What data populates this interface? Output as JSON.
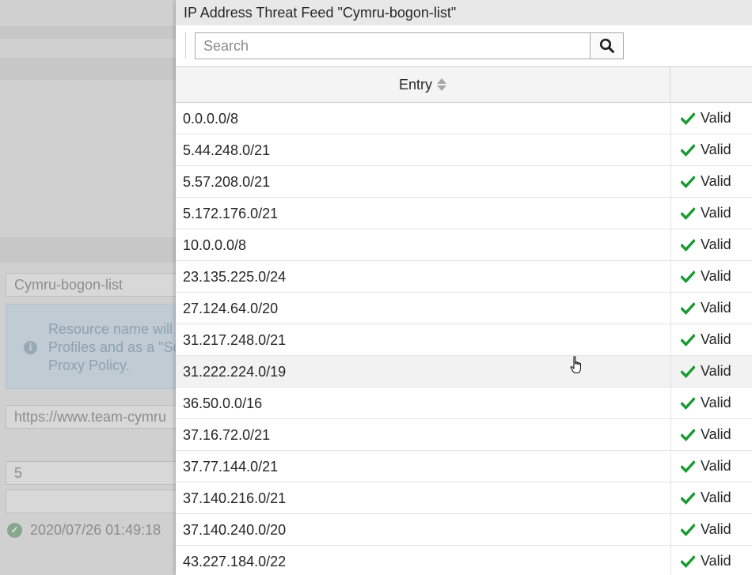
{
  "background": {
    "name_field": "Cymru-bogon-list",
    "info_lines": [
      "Resource name will",
      "Profiles and as a \"So",
      "Proxy Policy."
    ],
    "url_field": "https://www.team-cymru",
    "refresh_field": "5",
    "status_text": "2020/07/26 01:49:18",
    "status_color": "#2e9e3e"
  },
  "panel": {
    "title": "IP Address Threat Feed \"Cymru-bogon-list\"",
    "search": {
      "placeholder": "Search",
      "icon": "search-icon"
    },
    "table": {
      "columns": [
        {
          "label": "Entry",
          "sortable": true
        },
        {
          "label": ""
        }
      ],
      "rows": [
        {
          "entry": "0.0.0.0/8",
          "status": "Valid"
        },
        {
          "entry": "5.44.248.0/21",
          "status": "Valid"
        },
        {
          "entry": "5.57.208.0/21",
          "status": "Valid"
        },
        {
          "entry": "5.172.176.0/21",
          "status": "Valid"
        },
        {
          "entry": "10.0.0.0/8",
          "status": "Valid"
        },
        {
          "entry": "23.135.225.0/24",
          "status": "Valid"
        },
        {
          "entry": "27.124.64.0/20",
          "status": "Valid"
        },
        {
          "entry": "31.217.248.0/21",
          "status": "Valid"
        },
        {
          "entry": "31.222.224.0/19",
          "status": "Valid",
          "hovered": true
        },
        {
          "entry": "36.50.0.0/16",
          "status": "Valid"
        },
        {
          "entry": "37.16.72.0/21",
          "status": "Valid"
        },
        {
          "entry": "37.77.144.0/21",
          "status": "Valid"
        },
        {
          "entry": "37.140.216.0/21",
          "status": "Valid"
        },
        {
          "entry": "37.140.240.0/20",
          "status": "Valid"
        },
        {
          "entry": "43.227.184.0/22",
          "status": "Valid"
        }
      ]
    },
    "valid_color": "#1a9a32"
  }
}
